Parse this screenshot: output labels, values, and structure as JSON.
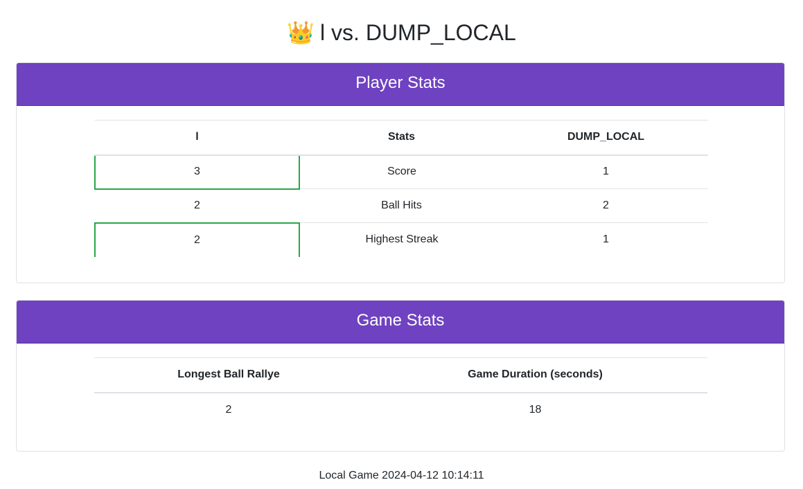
{
  "header": {
    "crown_icon": "👑",
    "player_left": "l",
    "vs_text": "vs.",
    "player_right": "DUMP_LOCAL"
  },
  "player_stats": {
    "title": "Player Stats",
    "columns": [
      "l",
      "Stats",
      "DUMP_LOCAL"
    ],
    "rows": [
      {
        "left": "3",
        "stat": "Score",
        "right": "1",
        "left_highlight": true
      },
      {
        "left": "2",
        "stat": "Ball Hits",
        "right": "2",
        "left_highlight": false
      },
      {
        "left": "2",
        "stat": "Highest Streak",
        "right": "1",
        "left_highlight": true
      }
    ]
  },
  "game_stats": {
    "title": "Game Stats",
    "columns": [
      "Longest Ball Rallye",
      "Game Duration (seconds)"
    ],
    "values": [
      "2",
      "18"
    ]
  },
  "footer": {
    "text": "Local Game 2024-04-12 10:14:11"
  },
  "colors": {
    "header_bg": "#6f42c1",
    "winner_border": "#28a745"
  }
}
